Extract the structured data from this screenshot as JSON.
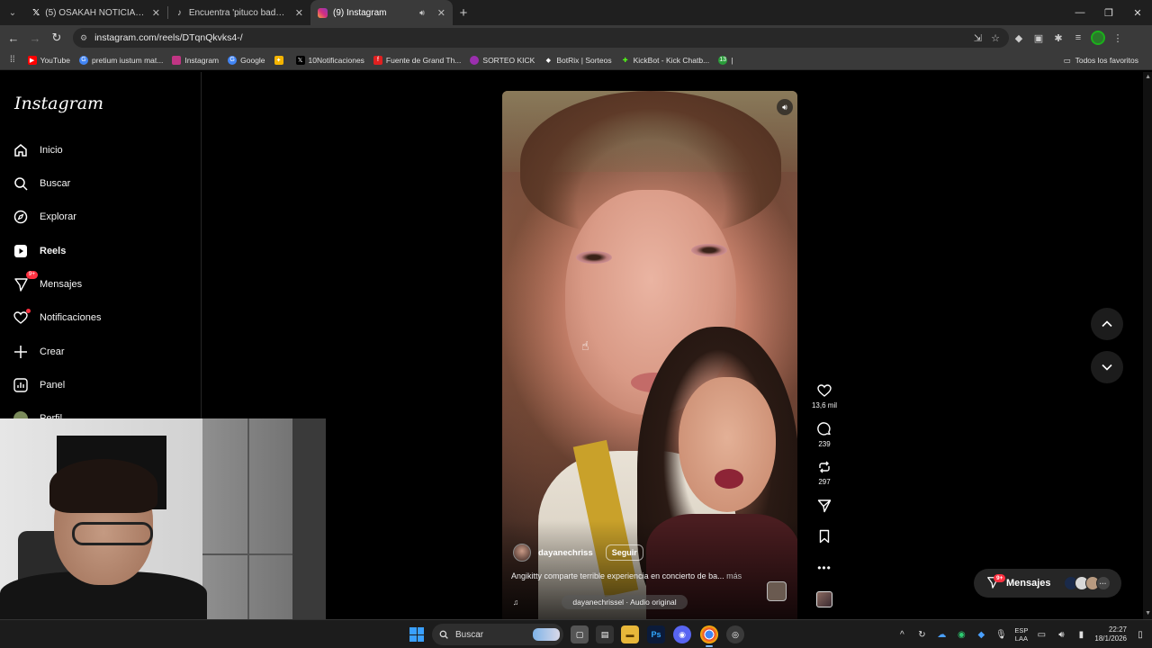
{
  "browser": {
    "tabs": [
      {
        "title": "(5) OSAKAH NOTICIAS en X: \"@",
        "favicon": "x-icon",
        "active": false
      },
      {
        "title": "Encuentra 'pituco badbunny' en",
        "favicon": "tiktok-icon",
        "active": false
      },
      {
        "title": "(9) Instagram",
        "favicon": "instagram-icon",
        "active": true
      }
    ],
    "url": "instagram.com/reels/DTqnQkvks4-/",
    "bookmarks": [
      {
        "label": "YouTube",
        "color": "#ff0000"
      },
      {
        "label": "pretium iustum mat...",
        "color": "#4285f4"
      },
      {
        "label": "Instagram",
        "color": "#c13584"
      },
      {
        "label": "Google",
        "color": "#4285f4"
      },
      {
        "label": "",
        "color": "#f4b400"
      },
      {
        "label": "10Notificaciones",
        "color": "#000000"
      },
      {
        "label": "Fuente de Grand Th...",
        "color": "#e02020"
      },
      {
        "label": "SORTEO KICK",
        "color": "#9b2fae"
      },
      {
        "label": "BotRix | Sorteos",
        "color": "#ffffff"
      },
      {
        "label": "KickBot - Kick Chatb...",
        "color": "#53fc18"
      },
      {
        "label": "|",
        "color": "#2a9d3a"
      }
    ],
    "bookmarks_all": "Todos los favoritos"
  },
  "sidebar": {
    "logo": "Instagram",
    "items": [
      {
        "label": "Inicio",
        "icon": "home-icon"
      },
      {
        "label": "Buscar",
        "icon": "search-icon"
      },
      {
        "label": "Explorar",
        "icon": "compass-icon"
      },
      {
        "label": "Reels",
        "icon": "reels-icon"
      },
      {
        "label": "Mensajes",
        "icon": "messenger-icon",
        "badge": "9+"
      },
      {
        "label": "Notificaciones",
        "icon": "heart-icon"
      },
      {
        "label": "Crear",
        "icon": "plus-icon"
      },
      {
        "label": "Panel",
        "icon": "chart-icon"
      },
      {
        "label": "Perfil",
        "icon": "profile-icon"
      }
    ]
  },
  "reel": {
    "author": "dayanechriss",
    "follow": "Seguir",
    "caption": "Angikitty comparte terrible experiencia en concierto de ba...",
    "more": "más",
    "audio": "dayanechrissel · Audio original"
  },
  "actions": {
    "likes": "13,6 mil",
    "comments": "239",
    "reposts": "297"
  },
  "messages_pill": {
    "label": "Mensajes",
    "badge": "9+"
  },
  "taskbar": {
    "search": "Buscar",
    "lang_top": "ESP",
    "lang_bottom": "LAA",
    "time": "22:27",
    "date": "18/1/2026"
  },
  "colors": {
    "accent_red": "#ff3040",
    "chrome_dark": "#1f1f1f",
    "chrome_mid": "#3a3a3a"
  }
}
